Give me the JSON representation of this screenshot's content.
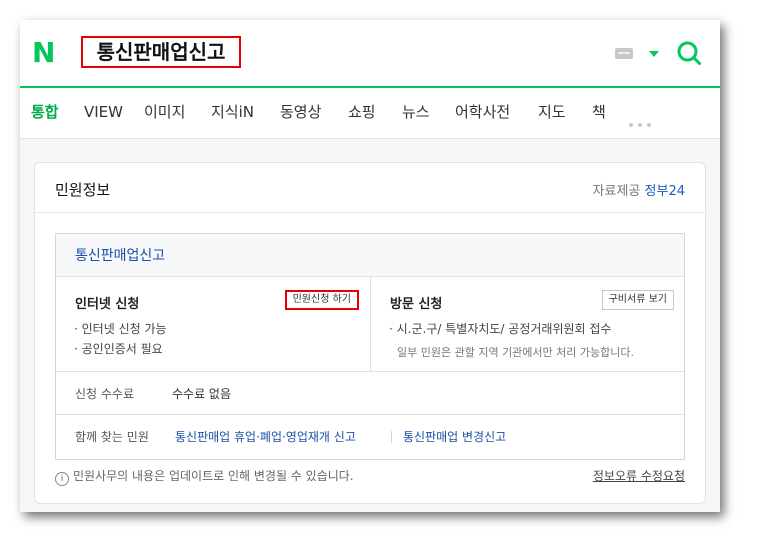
{
  "header": {
    "logo": "N",
    "query": "통신판매업신고",
    "colors": {
      "brand": "#03c75a",
      "highlight": "#e60000",
      "link": "#1a4fa8"
    }
  },
  "tabs": [
    {
      "label": "통합",
      "active": true
    },
    {
      "label": "VIEW"
    },
    {
      "label": "이미지"
    },
    {
      "label": "지식iN"
    },
    {
      "label": "동영상"
    },
    {
      "label": "쇼핑"
    },
    {
      "label": "뉴스"
    },
    {
      "label": "어학사전"
    },
    {
      "label": "지도"
    },
    {
      "label": "책"
    }
  ],
  "card": {
    "title": "민원정보",
    "provider_label": "자료제공",
    "provider_name": "정부24",
    "box_title": "통신판매업신고",
    "online": {
      "title": "인터넷 신청",
      "button": "민원신청 하기",
      "bullets": [
        "· 인터넷 신청 가능",
        "· 공인인증서 필요"
      ]
    },
    "visit": {
      "title": "방문 신청",
      "button": "구비서류 보기",
      "bullets": [
        "· 시.군.구/ 특별자치도/ 공정거래위원회 접수"
      ],
      "note": "일부 민원은 관할 지역 기관에서만 처리 가능합니다."
    },
    "fee": {
      "label": "신청 수수료",
      "value": "수수료 없음"
    },
    "related": {
      "label": "함께 찾는 민원",
      "links": [
        "통신판매업 휴업·폐업·영업재개 신고",
        "통신판매업 변경신고"
      ]
    },
    "footer_note": "민원사무의 내용은 업데이트로 인해 변경될 수 있습니다.",
    "report_link": "정보오류 수정요청"
  }
}
